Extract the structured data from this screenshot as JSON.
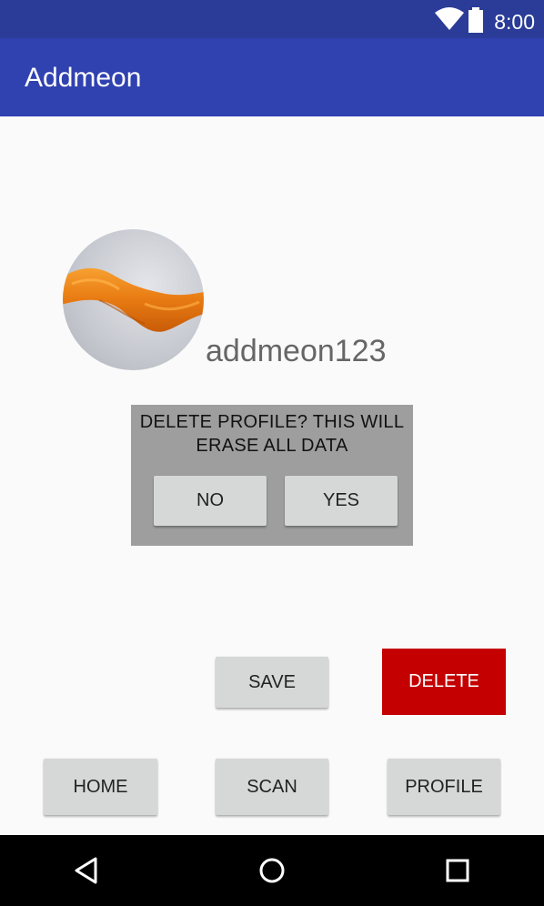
{
  "status_bar": {
    "time": "8:00",
    "icons": [
      "wifi-icon",
      "battery-icon"
    ]
  },
  "app_bar": {
    "title": "Addmeon"
  },
  "profile": {
    "avatar": "profile-photo",
    "username": "addmeon123"
  },
  "dialog": {
    "message_line1": "DELETE PROFILE? THIS WILL",
    "message_line2": "ERASE ALL DATA",
    "no_label": "NO",
    "yes_label": "YES"
  },
  "actions": {
    "save_label": "SAVE",
    "delete_label": "DELETE"
  },
  "bottom_buttons": {
    "home_label": "HOME",
    "scan_label": "SCAN",
    "profile_label": "PROFILE"
  },
  "nav_bar": {
    "icons": [
      "back-icon",
      "home-icon",
      "recents-icon"
    ]
  },
  "colors": {
    "status_bar": "#2a3c97",
    "app_bar": "#3041b0",
    "delete_button": "#c40000",
    "dialog_bg": "#9e9e9e",
    "button_bg": "#d6d7d7"
  }
}
